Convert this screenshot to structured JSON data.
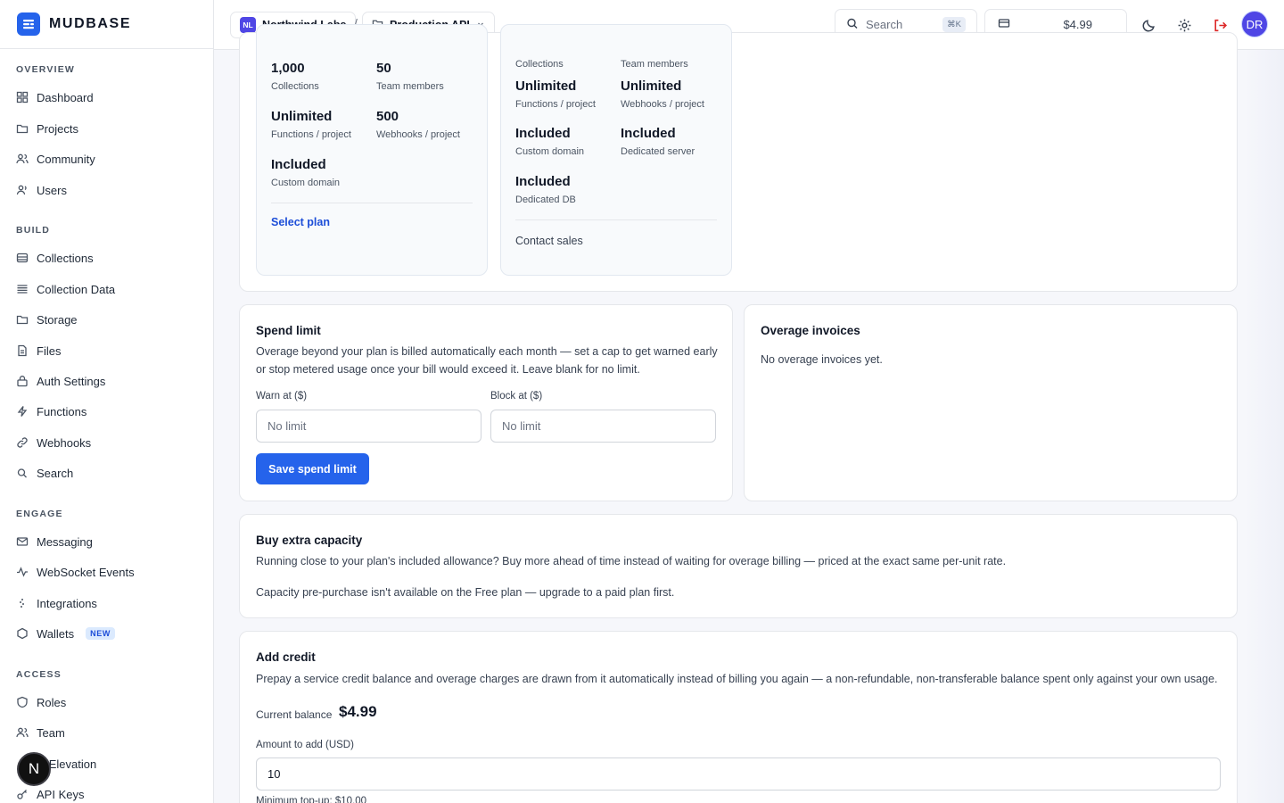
{
  "brand": {
    "name": "MUDBASE"
  },
  "sidebar": {
    "sections": [
      {
        "title": "OVERVIEW",
        "items": [
          {
            "label": "Dashboard",
            "icon": "dashboard-icon"
          },
          {
            "label": "Projects",
            "icon": "folder-icon"
          },
          {
            "label": "Community",
            "icon": "users-icon"
          },
          {
            "label": "Users",
            "icon": "user-icon"
          }
        ]
      },
      {
        "title": "BUILD",
        "items": [
          {
            "label": "Collections",
            "icon": "database-icon"
          },
          {
            "label": "Collection Data",
            "icon": "list-icon"
          },
          {
            "label": "Storage",
            "icon": "folder-icon"
          },
          {
            "label": "Files",
            "icon": "file-icon"
          },
          {
            "label": "Auth Settings",
            "icon": "lock-icon"
          },
          {
            "label": "Functions",
            "icon": "bolt-icon"
          },
          {
            "label": "Webhooks",
            "icon": "link-icon"
          },
          {
            "label": "Search",
            "icon": "search-icon"
          }
        ]
      },
      {
        "title": "ENGAGE",
        "items": [
          {
            "label": "Messaging",
            "icon": "mail-icon"
          },
          {
            "label": "WebSocket Events",
            "icon": "activity-icon"
          },
          {
            "label": "Integrations",
            "icon": "plug-icon"
          },
          {
            "label": "Wallets",
            "icon": "hexagon-icon",
            "badge": "NEW"
          }
        ]
      },
      {
        "title": "ACCESS",
        "items": [
          {
            "label": "Roles",
            "icon": "shield-icon"
          },
          {
            "label": "Team",
            "icon": "users-icon"
          },
          {
            "label": "le Elevation",
            "icon": "elevation-icon"
          },
          {
            "label": "API Keys",
            "icon": "key-icon"
          }
        ]
      }
    ],
    "floating_avatar": "N"
  },
  "topbar": {
    "org": {
      "initials": "NL",
      "name": "Northwind Labs"
    },
    "separator": "/",
    "project": {
      "name": "Production API"
    },
    "search": {
      "placeholder": "Search",
      "shortcut": "⌘K"
    },
    "balance": "$4.99",
    "user_initials": "DR"
  },
  "plans": {
    "left": {
      "stats": [
        {
          "value": "1,000",
          "label": "Collections"
        },
        {
          "value": "50",
          "label": "Team members"
        },
        {
          "value": "Unlimited",
          "label": "Functions / project"
        },
        {
          "value": "500",
          "label": "Webhooks / project"
        },
        {
          "value": "Included",
          "label": "Custom domain"
        }
      ],
      "action": "Select plan"
    },
    "right": {
      "top_labels": [
        "Collections",
        "Team members"
      ],
      "stats": [
        {
          "value": "Unlimited",
          "label": "Functions / project"
        },
        {
          "value": "Unlimited",
          "label": "Webhooks / project"
        },
        {
          "value": "Included",
          "label": "Custom domain"
        },
        {
          "value": "Included",
          "label": "Dedicated server"
        },
        {
          "value": "Included",
          "label": "Dedicated DB"
        }
      ],
      "action": "Contact sales"
    }
  },
  "spend_limit": {
    "title": "Spend limit",
    "description": "Overage beyond your plan is billed automatically each month — set a cap to get warned early or stop metered usage once your bill would exceed it. Leave blank for no limit.",
    "warn_label": "Warn at ($)",
    "warn_placeholder": "No limit",
    "block_label": "Block at ($)",
    "block_placeholder": "No limit",
    "save_button": "Save spend limit"
  },
  "overage_invoices": {
    "title": "Overage invoices",
    "empty_text": "No overage invoices yet."
  },
  "extra_capacity": {
    "title": "Buy extra capacity",
    "description": "Running close to your plan's included allowance? Buy more ahead of time instead of waiting for overage billing — priced at the exact same per-unit rate.",
    "notice": "Capacity pre-purchase isn't available on the Free plan — upgrade to a paid plan first."
  },
  "add_credit": {
    "title": "Add credit",
    "description": "Prepay a service credit balance and overage charges are drawn from it automatically instead of billing you again — a non-refundable, non-transferable balance spent only against your own usage.",
    "balance_label": "Current balance",
    "balance_value": "$4.99",
    "amount_label": "Amount to add (USD)",
    "amount_value": "10",
    "min_note": "Minimum top-up: $10.00"
  },
  "colors": {
    "accent": "#2563eb",
    "brand": "#2563eb",
    "org_badge": "#4f46e5",
    "logout": "#dc2626"
  }
}
